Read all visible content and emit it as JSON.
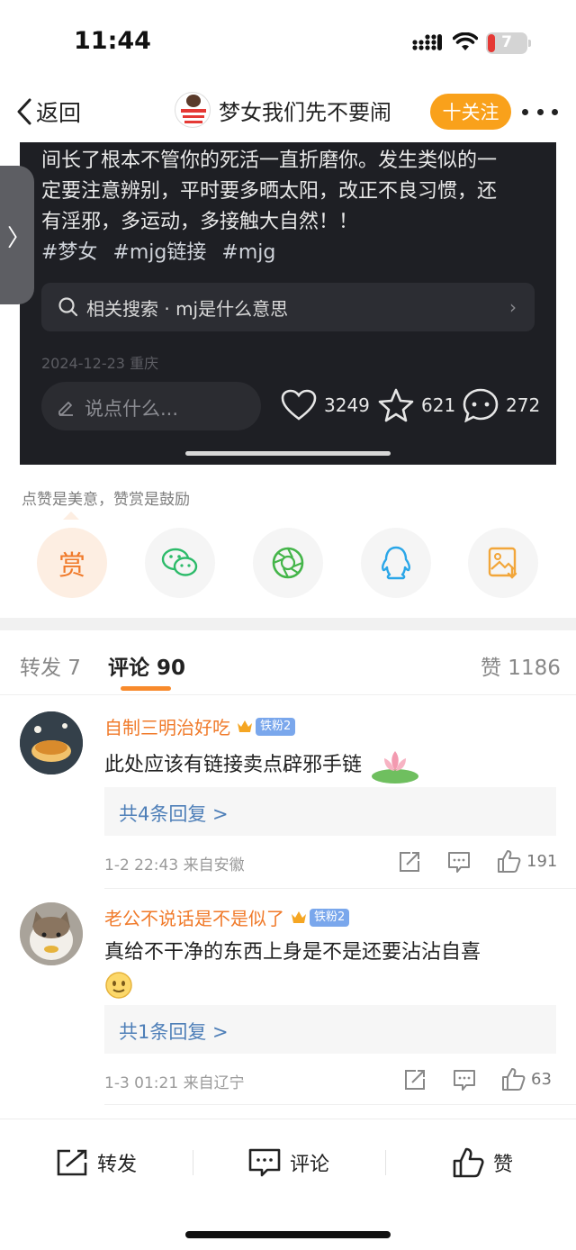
{
  "status_bar": {
    "time": "11:44",
    "battery": "7"
  },
  "nav": {
    "back_label": "返回",
    "title": "梦女我们先不要闹",
    "follow_label": "十关注"
  },
  "post": {
    "text_line1": "间长了根本不管你的死活一直折磨你。发生类似的一",
    "text_line2": "定要注意辨别，平时要多晒太阳，改正不良习惯，还",
    "text_line3": "有淫邪，多运动，多接触大自然！！",
    "tags": [
      "#梦女",
      "#mjg链接",
      "#mjg"
    ],
    "related_search": "相关搜索 · mj是什么意思",
    "meta": "2024-12-23  重庆",
    "comment_placeholder": "说点什么...",
    "likes": "3249",
    "favorites": "621",
    "comments": "272"
  },
  "reward": {
    "note": "点赞是美意，赞赏是鼓励",
    "reward_label": "赏"
  },
  "tabs": {
    "repost": "转发 7",
    "comments": "评论 90",
    "likes": "赞 1186"
  },
  "comments": [
    {
      "name": "自制三明治好吃",
      "badge": "铁粉2",
      "text": "此处应该有链接卖点辟邪手链",
      "replies": "共4条回复 >",
      "time": "1-2 22:43  来自安徽",
      "likes": "191"
    },
    {
      "name": "老公不说话是不是似了",
      "badge": "铁粉2",
      "text": "真给不干净的东西上身是不是还要沾沾自喜",
      "replies": "共1条回复 >",
      "time": "1-3 01:21  来自辽宁",
      "likes": "63"
    }
  ],
  "bottom_bar": {
    "repost": "转发",
    "comment": "评论",
    "like": "赞"
  },
  "colors": {
    "accent_orange": "#f88a2c",
    "follow_btn": "#f9a11b",
    "link_blue": "#4e7fb8",
    "dark_card": "#1e1f24"
  }
}
